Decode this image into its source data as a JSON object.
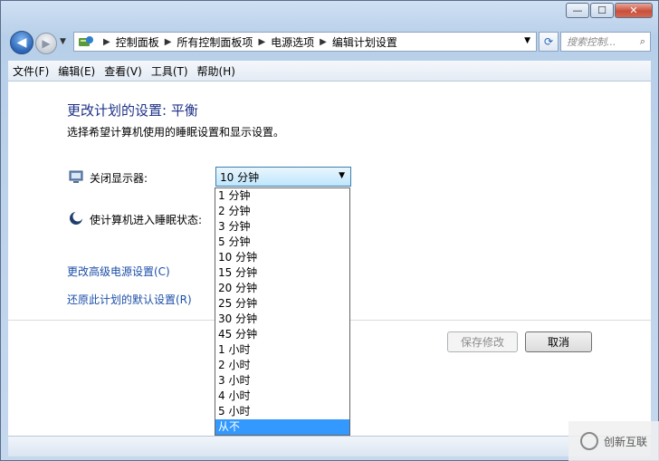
{
  "window": {
    "minimize_glyph": "—",
    "maximize_glyph": "☐",
    "close_glyph": "✕"
  },
  "nav": {
    "breadcrumbs": [
      "控制面板",
      "所有控制面板项",
      "电源选项",
      "编辑计划设置"
    ],
    "search_placeholder": "搜索控制...",
    "accent": "#2a64b7"
  },
  "menu": [
    "文件(F)",
    "编辑(E)",
    "查看(V)",
    "工具(T)",
    "帮助(H)"
  ],
  "page": {
    "title": "更改计划的设置: 平衡",
    "subtitle": "选择希望计算机使用的睡眠设置和显示设置。",
    "display_off_label": "关闭显示器:",
    "display_off_value": "10 分钟",
    "sleep_label": "使计算机进入睡眠状态:",
    "link_advanced": "更改高级电源设置(C)",
    "link_restore": "还原此计划的默认设置(R)",
    "save_button": "保存修改",
    "cancel_button": "取消",
    "title_color": "#1e3287",
    "link_color": "#1c4ea8"
  },
  "dropdown": {
    "options": [
      "1 分钟",
      "2 分钟",
      "3 分钟",
      "5 分钟",
      "10 分钟",
      "15 分钟",
      "20 分钟",
      "25 分钟",
      "30 分钟",
      "45 分钟",
      "1 小时",
      "2 小时",
      "3 小时",
      "4 小时",
      "5 小时",
      "从不"
    ],
    "highlighted": "从不",
    "highlight_color": "#3399ff"
  },
  "watermark": {
    "text": "创新互联"
  }
}
